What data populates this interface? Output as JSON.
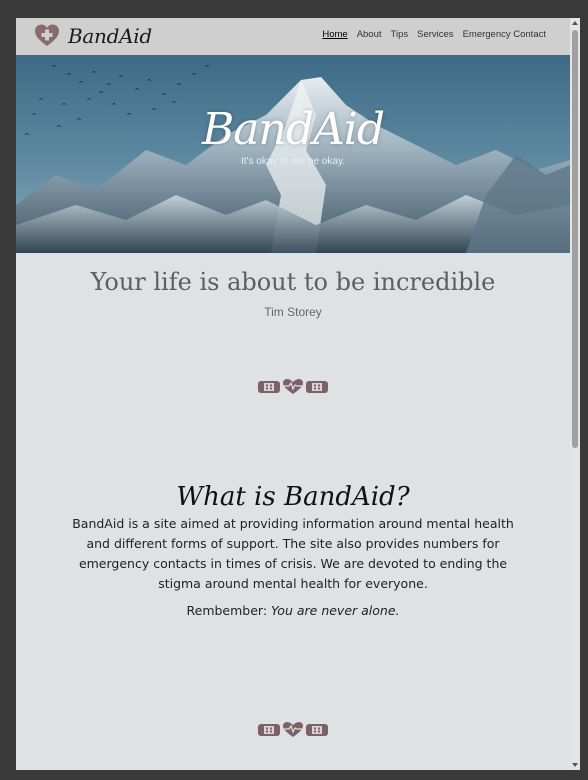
{
  "navbar": {
    "brand": "BandAid",
    "links": [
      "Home",
      "About",
      "Tips",
      "Services",
      "Emergency Contact"
    ]
  },
  "hero": {
    "title": "BandAid",
    "subtitle": "It's okay to not be okay."
  },
  "quote": {
    "text": "Your life is about to be incredible",
    "author": "Tim Storey"
  },
  "about": {
    "title": "What is BandAid?",
    "body": "BandAid is a site aimed at providing information around mental health and different forms of support. The site also provides numbers for emergency contacts in times of crisis. We are devoted to ending the stigma around mental health for everyone.",
    "remember_label": "Rembember:",
    "remember_text": "You are never alone."
  },
  "colors": {
    "navbar_bg": "#cfcfcf",
    "page_bg": "#dfe2e5",
    "accent": "#7a6266"
  },
  "icons": [
    "heart-plus-logo-icon",
    "bandage-heartbeat-icon"
  ]
}
